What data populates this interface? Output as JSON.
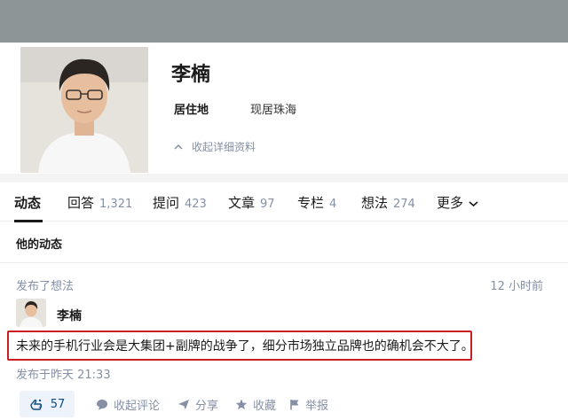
{
  "profile": {
    "name": "李楠",
    "location_label": "居住地",
    "location_value": "现居珠海",
    "collapse_label": "收起详细资料"
  },
  "tabs": [
    {
      "label": "动态",
      "count": ""
    },
    {
      "label": "回答",
      "count": "1,321"
    },
    {
      "label": "提问",
      "count": "423"
    },
    {
      "label": "文章",
      "count": "97"
    },
    {
      "label": "专栏",
      "count": "4"
    },
    {
      "label": "想法",
      "count": "274"
    },
    {
      "label": "更多",
      "count": ""
    }
  ],
  "feed": {
    "section_title": "他的动态",
    "action_text": "发布了想法",
    "time": "12 小时前",
    "author": "李楠",
    "content": "未来的手机行业会是大集团+副牌的战争了，细分市场独立品牌也的确机会不大了。",
    "date": "发布于昨天 21:33",
    "votes": "57",
    "actions": {
      "comments": "收起评论",
      "share": "分享",
      "collect": "收藏",
      "report": "举报"
    }
  },
  "colors": {
    "highlight_border": "#cc1e22",
    "muted_text": "#8590a6",
    "vote_text": "#0f4c81"
  }
}
